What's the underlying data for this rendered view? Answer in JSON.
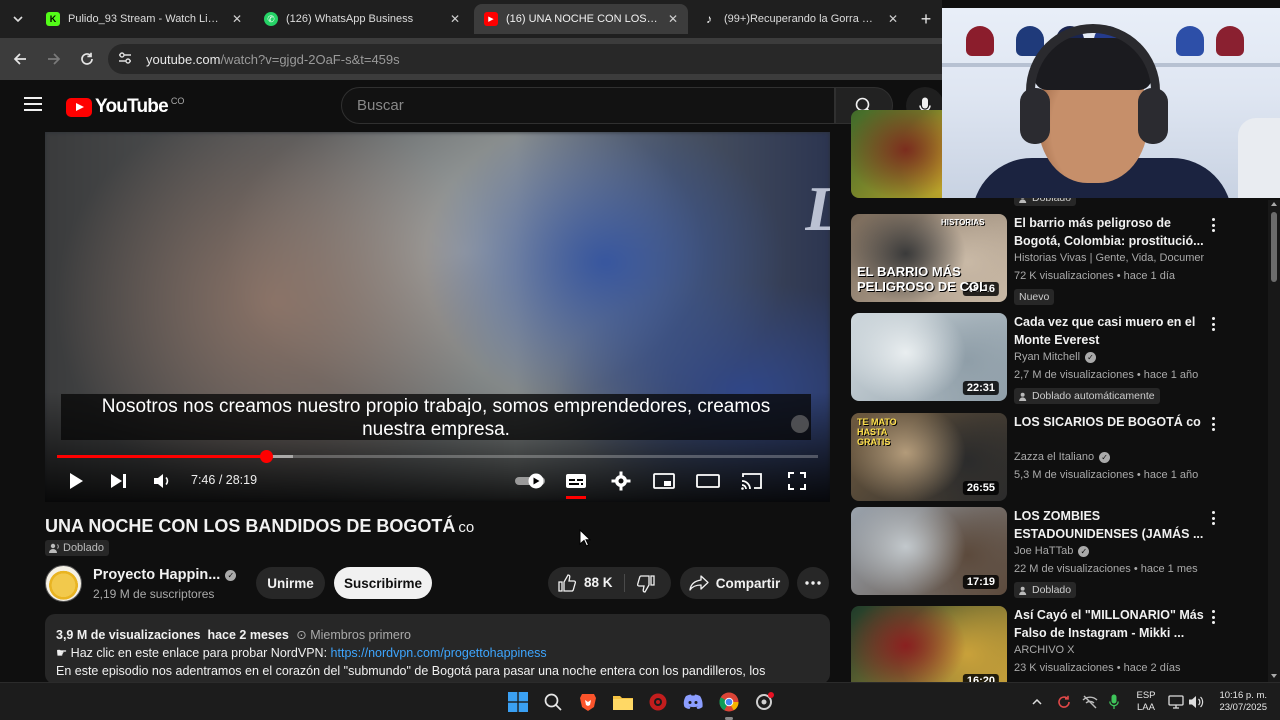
{
  "browser": {
    "tabs": [
      {
        "title": "Pulido_93 Stream - Watch Live on Kick",
        "favicon": "kick-icon",
        "active": false
      },
      {
        "title": "(126) WhatsApp Business",
        "favicon": "whatsapp-icon",
        "active": false
      },
      {
        "title": "(16) UNA NOCHE CON LOS BANDIDOS",
        "favicon": "youtube-icon",
        "active": true
      },
      {
        "title": "(99+)Recuperando la Gorra Vieja Escu",
        "favicon": "tiktok-icon",
        "active": false
      }
    ],
    "url_host": "youtube.com",
    "url_path": "/watch?v=gjgd-2OaF-s&t=459s"
  },
  "youtube": {
    "logo_text": "YouTube",
    "country": "CO",
    "search_placeholder": "Buscar"
  },
  "player": {
    "subtitle_line1": "Nosotros nos creamos nuestro propio trabajo, somos emprendedores, creamos",
    "subtitle_line2": "nuestra empresa.",
    "time_current": "7:46",
    "time_total": "28:19",
    "progress_fraction": 0.274,
    "buffered_fraction": 0.31,
    "autoplay_on": true,
    "captions_on": true
  },
  "video": {
    "title": "UNA NOCHE CON LOS BANDIDOS DE BOGOTÁ",
    "title_suffix": "co",
    "dub_badge": "Doblado",
    "channel_name": "Proyecto Happin...",
    "subscribers": "2,19 M de suscriptores",
    "join_label": "Unirme",
    "subscribe_label": "Suscribirme",
    "likes": "88 K",
    "share_label": "Compartir",
    "desc_views": "3,9 M de visualizaciones",
    "desc_age": "hace 2 meses",
    "desc_members": "Miembros primero",
    "desc_line2_text": "☛ Haz clic en este enlace para probar NordVPN:",
    "desc_line2_link": "https://nordvpn.com/progettohappiness",
    "desc_line3": "En este episodio nos adentramos en el corazón del \"submundo\" de Bogotá para pasar una noche entera con los pandilleros, los"
  },
  "recommendations": [
    {
      "title": "",
      "channel": "",
      "meta": "",
      "badge": "Doblado",
      "duration": "",
      "thumb_colors": [
        "#3f6a2a",
        "#d8b12a",
        "#7b2d1e"
      ]
    },
    {
      "title": "El barrio más peligroso de Bogotá, Colombia: prostitució...",
      "channel": "Historias Vivas | Gente, Vida, Documenta...",
      "meta": "72 K visualizaciones • hace 1 día",
      "badge": "Nuevo",
      "duration": "48:16",
      "thumb_text": "EL BARRIO MÁS PELIGROSO DE COL",
      "thumb_top_text": "HISTORIAS",
      "thumb_colors": [
        "#7a6a5a",
        "#c9b9a6",
        "#3a3a3a"
      ]
    },
    {
      "title": "Cada vez que casi muero en el Monte Everest",
      "channel": "Ryan Mitchell",
      "verified": true,
      "meta": "2,7 M de visualizaciones • hace 1 año",
      "badge": "Doblado automáticamente",
      "duration": "22:31",
      "thumb_colors": [
        "#cfd8dd",
        "#8f9ea8",
        "#e9eef0"
      ]
    },
    {
      "title": "LOS SICARIOS DE BOGOTÁ co",
      "channel": "Zazza el Italiano",
      "verified": true,
      "meta": "5,3 M de visualizaciones • hace 1 año",
      "badge": "",
      "duration": "26:55",
      "thumb_text": "TE MATO HASTA GRATIS",
      "thumb_colors": [
        "#6e5a40",
        "#2b2b2b",
        "#b39b7a"
      ]
    },
    {
      "title": "LOS ZOMBIES ESTADOUNIDENSES (JAMÁS ...",
      "channel": "Joe HaTTab",
      "verified": true,
      "meta": "22 M de visualizaciones • hace 1 mes",
      "badge": "Doblado",
      "duration": "17:19",
      "thumb_colors": [
        "#9aa3ad",
        "#5c4a3c",
        "#c2c8cc"
      ]
    },
    {
      "title": "Así Cayó el \"MILLONARIO\" Más Falso de Instagram - Mikki ...",
      "channel": "ARCHIVO X",
      "verified": false,
      "meta": "23 K visualizaciones • hace 2 días",
      "badge": "",
      "duration": "16:20",
      "thumb_colors": [
        "#1e3b2a",
        "#c9a13a",
        "#8a2020"
      ]
    }
  ],
  "taskbar": {
    "lang_line1": "ESP",
    "lang_line2": "LAA",
    "time": "10:16 p. m.",
    "date": "23/07/2025"
  },
  "colors": {
    "accent_red": "#ff0000",
    "link_blue": "#3ea6ff",
    "bg": "#0f0f0f",
    "pill": "#272727"
  }
}
